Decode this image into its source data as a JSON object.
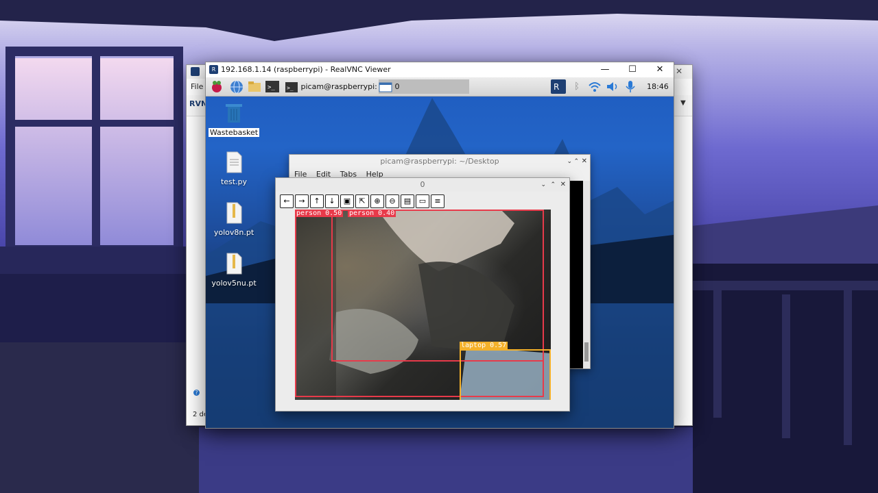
{
  "colors": {
    "person_box": "#e83a4a",
    "laptop_box": "#f4b12a",
    "vnc_logo": "#1e3f73",
    "wastebasket": "#2874b8"
  },
  "back_window": {
    "menu_file": "File",
    "logo_text": "RVNC",
    "status_text": "2 de"
  },
  "vnc": {
    "title": "192.168.1.14 (raspberrypi) - RealVNC Viewer",
    "minimize_icon": "minimize-icon",
    "maximize_icon": "maximize-icon",
    "close_icon": "close-icon"
  },
  "taskbar": {
    "terminal_task": "picam@raspberrypi: ...",
    "image_task": "0",
    "clock": "18:46"
  },
  "desktop_icons": [
    {
      "label": "Wastebasket",
      "icon": "trash-icon"
    },
    {
      "label": "test.py",
      "icon": "text-file-icon"
    },
    {
      "label": "yolov8n.pt",
      "icon": "archive-file-icon"
    },
    {
      "label": "yolov5nu.pt",
      "icon": "archive-file-icon"
    }
  ],
  "terminal": {
    "title": "picam@raspberrypi: ~/Desktop",
    "menu": [
      "File",
      "Edit",
      "Tabs",
      "Help"
    ]
  },
  "image_window": {
    "title": "0",
    "toolbar": [
      "back-arrow-icon",
      "forward-arrow-icon",
      "up-arrow-icon",
      "down-arrow-icon",
      "fit-icon",
      "export-icon",
      "zoom-in-icon",
      "zoom-out-icon",
      "save-icon",
      "clipboard-icon",
      "properties-icon"
    ],
    "detections": [
      {
        "label": "person 0.50"
      },
      {
        "label": "person 0.40"
      },
      {
        "label": "laptop 0.57"
      }
    ]
  }
}
